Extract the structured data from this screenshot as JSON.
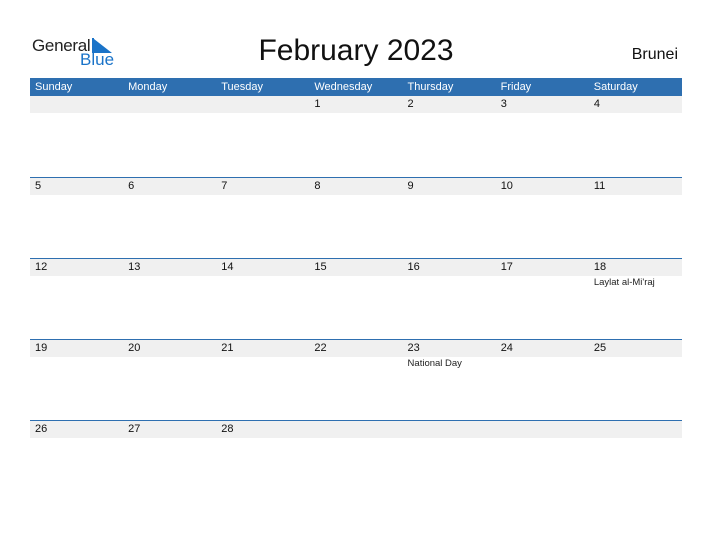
{
  "logo": {
    "line1": "General",
    "line2": "Blue"
  },
  "title": "February 2023",
  "country": "Brunei",
  "colors": {
    "header_bg": "#2e6fb0",
    "strip_bg": "#f0f0f0",
    "logo_blue": "#1a73c8"
  },
  "weekdays": [
    "Sunday",
    "Monday",
    "Tuesday",
    "Wednesday",
    "Thursday",
    "Friday",
    "Saturday"
  ],
  "weeks": [
    [
      {
        "day": ""
      },
      {
        "day": ""
      },
      {
        "day": ""
      },
      {
        "day": "1"
      },
      {
        "day": "2"
      },
      {
        "day": "3"
      },
      {
        "day": "4"
      }
    ],
    [
      {
        "day": "5"
      },
      {
        "day": "6"
      },
      {
        "day": "7"
      },
      {
        "day": "8"
      },
      {
        "day": "9"
      },
      {
        "day": "10"
      },
      {
        "day": "11"
      }
    ],
    [
      {
        "day": "12"
      },
      {
        "day": "13"
      },
      {
        "day": "14"
      },
      {
        "day": "15"
      },
      {
        "day": "16"
      },
      {
        "day": "17"
      },
      {
        "day": "18",
        "event": "Laylat al-Mi'raj"
      }
    ],
    [
      {
        "day": "19"
      },
      {
        "day": "20"
      },
      {
        "day": "21"
      },
      {
        "day": "22"
      },
      {
        "day": "23",
        "event": "National Day"
      },
      {
        "day": "24"
      },
      {
        "day": "25"
      }
    ],
    [
      {
        "day": "26"
      },
      {
        "day": "27"
      },
      {
        "day": "28"
      },
      {
        "day": ""
      },
      {
        "day": ""
      },
      {
        "day": ""
      },
      {
        "day": ""
      }
    ]
  ]
}
